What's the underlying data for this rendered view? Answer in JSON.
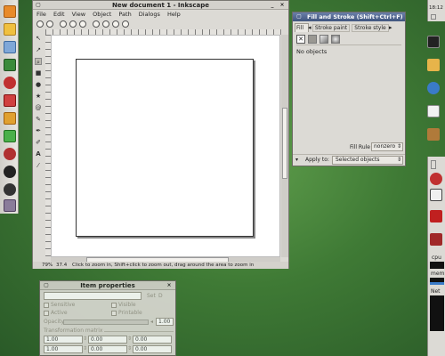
{
  "inkscape": {
    "title": "New document 1 - Inkscape",
    "menu": [
      "File",
      "Edit",
      "View",
      "Object",
      "Path",
      "Dialogs",
      "Help"
    ],
    "status": {
      "zoom": "79%",
      "coords": "37.4",
      "message": "Click to zoom in, Shift+click to zoom out, drag around the area to zoom in"
    }
  },
  "fill_stroke": {
    "title": "Fill and Stroke (Shift+Ctrl+F)",
    "tab_fill": "Fill",
    "tab_stroke_paint": "Stroke paint",
    "tab_stroke_style": "Stroke style",
    "no_objects": "No objects",
    "fill_rule_label": "Fill Rule",
    "fill_rule_value": "nonzero",
    "apply_to_label": "Apply to:",
    "apply_to_value": "Selected objects"
  },
  "item_props": {
    "title": "Item properties",
    "set_button": "Set",
    "id_field": "",
    "sensitive": "Sensitive",
    "active": "Active",
    "visible": "Visible",
    "printable": "Printable",
    "opacity_label": "Opacity:",
    "opacity_value": "1.00",
    "transform_label": "Transformation matrix",
    "matrix": [
      "1.00",
      "0.00",
      "0.00",
      "1.00",
      "0.00",
      "0.00"
    ]
  },
  "right_panel": {
    "clock": "18:12",
    "cpu": "cpu",
    "mem": "mem",
    "net": "Net"
  },
  "colors": {
    "desktop": "#3f7a35",
    "title_active": "#41567f",
    "gtk": "#dcdad5"
  }
}
